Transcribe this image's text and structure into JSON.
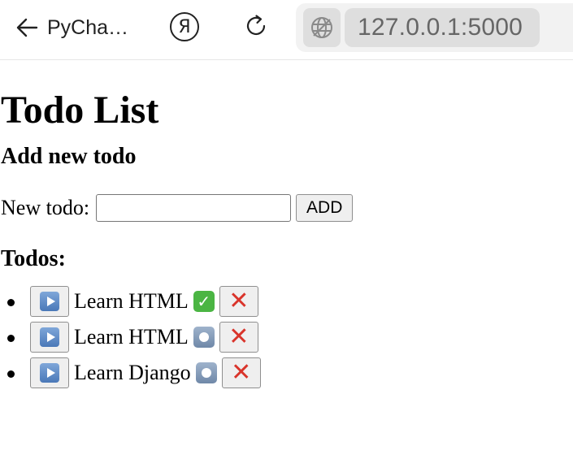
{
  "browser": {
    "back_label": "PyCha…",
    "yandex_glyph": "Я",
    "url": "127.0.0.1:5000"
  },
  "page": {
    "title": "Todo List",
    "add_heading": "Add new todo",
    "new_todo_label": "New todo:",
    "new_todo_value": "",
    "add_button_label": "ADD",
    "todos_heading": "Todos:"
  },
  "todos": [
    {
      "text": "Learn HTML",
      "status": "done",
      "status_icon": "check-mark-button-icon"
    },
    {
      "text": "Learn HTML",
      "status": "open",
      "status_icon": "radio-button-icon"
    },
    {
      "text": "Learn Django",
      "status": "open",
      "status_icon": "radio-button-icon"
    }
  ],
  "colors": {
    "delete_icon": "#d9342b",
    "done_icon": "#4bb543",
    "url_text": "#666666"
  }
}
